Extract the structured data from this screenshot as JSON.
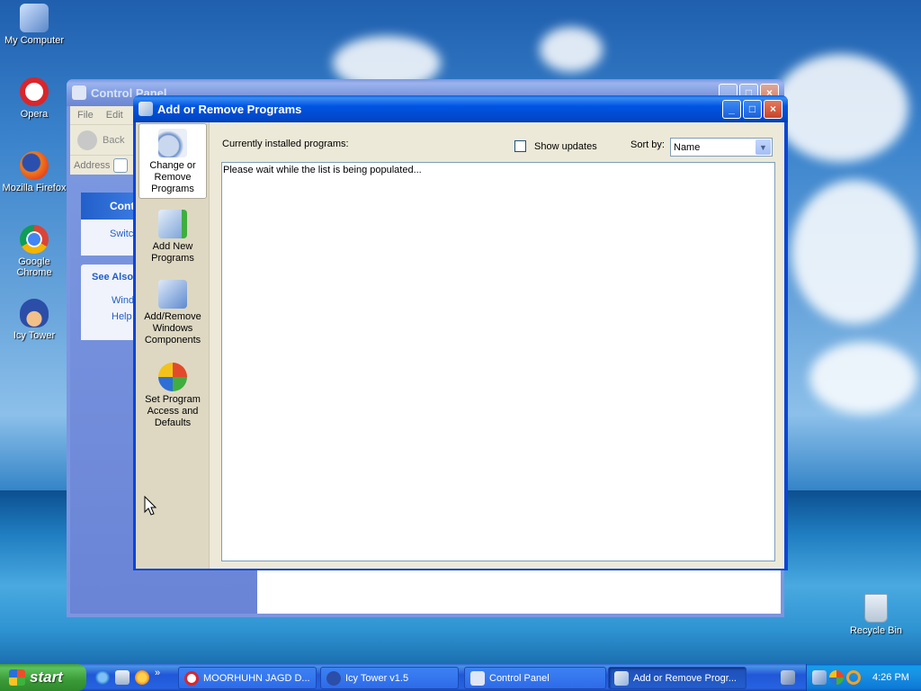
{
  "desktop": {
    "icons": [
      {
        "label": "My Computer"
      },
      {
        "label": "Opera"
      },
      {
        "label": "Mozilla Firefox"
      },
      {
        "label": "Google Chrome"
      },
      {
        "label": "Icy Tower"
      },
      {
        "label": "Recycle Bin"
      }
    ]
  },
  "control_panel": {
    "title": "Control Panel",
    "menu": [
      "File",
      "Edit"
    ],
    "back_label": "Back",
    "address_label": "Address",
    "panel_heading": "Cont",
    "panel_switch": "Switc",
    "see_also": "See Also",
    "see_also_items": [
      "Windo",
      "Help"
    ]
  },
  "arp": {
    "title": "Add or Remove Programs",
    "sidebar": [
      {
        "label": "Change or Remove Programs"
      },
      {
        "label": "Add New Programs"
      },
      {
        "label": "Add/Remove Windows Components"
      },
      {
        "label": "Set Program Access and Defaults"
      }
    ],
    "installed_label": "Currently installed programs:",
    "show_updates": "Show updates",
    "sort_by_label": "Sort by:",
    "sort_value": "Name",
    "status_text": "Please wait while the list is being populated..."
  },
  "taskbar": {
    "start_label": "start",
    "quicklaunch_more": "»",
    "tasks": [
      {
        "label": "MOORHUHN JAGD D..."
      },
      {
        "label": "Icy Tower v1.5"
      },
      {
        "label": "Control Panel"
      },
      {
        "label": "Add or Remove Progr..."
      }
    ],
    "clock": "4:26 PM"
  }
}
